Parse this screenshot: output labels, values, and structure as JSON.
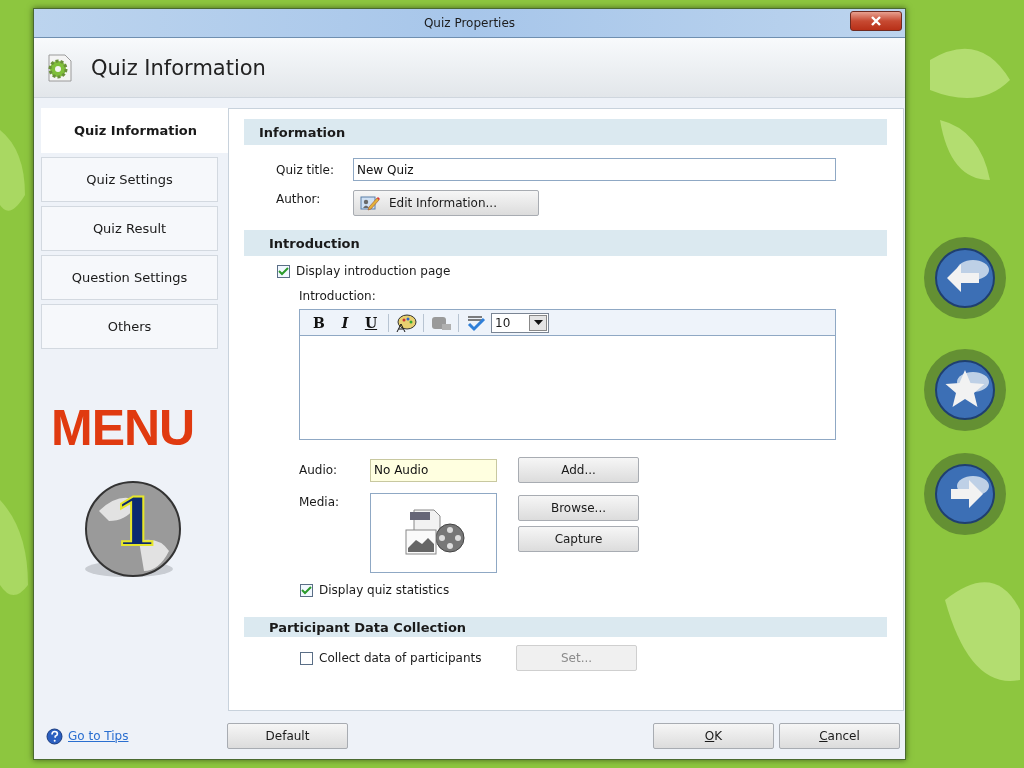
{
  "window": {
    "title": "Quiz Properties"
  },
  "header": {
    "title": "Quiz Information"
  },
  "sidebar": {
    "items": [
      {
        "label": "Quiz Information",
        "selected": true
      },
      {
        "label": "Quiz Settings",
        "selected": false
      },
      {
        "label": "Quiz Result",
        "selected": false
      },
      {
        "label": "Question Settings",
        "selected": false
      },
      {
        "label": "Others",
        "selected": false
      }
    ],
    "logo": {
      "text": "MENU",
      "badge": "1"
    }
  },
  "information": {
    "heading": "Information",
    "quiz_title": {
      "label": "Quiz title:",
      "value": "New Quiz"
    },
    "author": {
      "label": "Author:",
      "button": "Edit Information..."
    }
  },
  "introduction": {
    "heading": "Introduction",
    "display_checkbox": {
      "label": "Display introduction page",
      "checked": true
    },
    "editor_label": "Introduction:",
    "toolbar": {
      "bold": "B",
      "italic": "I",
      "underline": "U",
      "font_size": "10"
    },
    "audio": {
      "label": "Audio:",
      "value": "No Audio",
      "button": "Add..."
    },
    "media": {
      "label": "Media:",
      "buttons": [
        "Browse...",
        "Capture"
      ]
    },
    "statistics_checkbox": {
      "label": "Display quiz statistics",
      "checked": true
    }
  },
  "participant": {
    "heading": "Participant Data Collection",
    "collect_checkbox": {
      "label": "Collect data of participants",
      "checked": false
    },
    "set_button": {
      "label": "Set...",
      "disabled": true
    }
  },
  "footer": {
    "tips_link": "Go to Tips",
    "buttons": [
      {
        "label": "Default"
      },
      {
        "label": "OK",
        "underline_first": true
      },
      {
        "label": "Cancel",
        "underline_first": true
      }
    ]
  },
  "nav": [
    {
      "kind": "back"
    },
    {
      "kind": "star"
    },
    {
      "kind": "forward"
    }
  ]
}
